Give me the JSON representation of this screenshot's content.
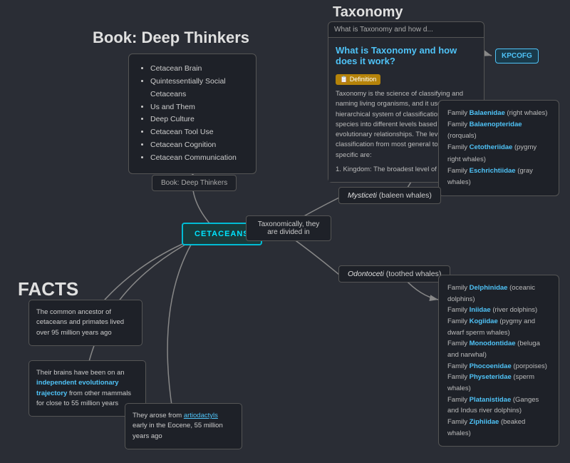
{
  "book": {
    "title": "Book: Deep Thinkers",
    "chapters": [
      "Cetacean Brain",
      "Quintessentially Social Cetaceans",
      "Us and Them",
      "Deep Culture",
      "Cetacean Tool Use",
      "Cetacean Cognition",
      "Cetacean Communication"
    ],
    "label": "Book: Deep Thinkers"
  },
  "taxonomy": {
    "title": "Taxonomy",
    "header": "What is Taxonomy and how d...",
    "card_title": "What is Taxonomy and how does it work?",
    "definition_badge": "📋 Definition",
    "body": "Taxonomy is the science of classifying and naming living organisms, and it uses a hierarchical system of classification to organize species into different levels based on their evolutionary relationships. The levels of classification from most general to most specific are:",
    "kingdom_line": "1. Kingdom: The broadest level of",
    "kpcofg": "KPCOFG"
  },
  "baleen_families": {
    "items": [
      {
        "name": "Balaenidae",
        "desc": " (right whales)"
      },
      {
        "name": "Balaenopteridae",
        "desc": " (rorquals)"
      },
      {
        "name": "Cetotheriidae",
        "desc": " (pygmy right whales)"
      },
      {
        "name": "Eschrichtiidae",
        "desc": " (gray whales)"
      }
    ]
  },
  "mysticeti": {
    "label": "Mysticeti (baleen whales)"
  },
  "cetaceans": {
    "label": "CETACEANS"
  },
  "taxonomically": {
    "label": "Taxonomically, they are divided in"
  },
  "odontoceti": {
    "label": "Odontoceti (toothed whales)"
  },
  "toothed_families": {
    "items": [
      {
        "name": "Delphinidae",
        "desc": " (oceanic dolphins)"
      },
      {
        "name": "Iniidae",
        "desc": " (river dolphins)"
      },
      {
        "name": "Kogiidae",
        "desc": " (pygmy and dwarf sperm whales)"
      },
      {
        "name": "Monodontidae",
        "desc": " (beluga and narwhal)"
      },
      {
        "name": "Phocoenidae",
        "desc": " (porpoises)"
      },
      {
        "name": "Physeteridae",
        "desc": " (sperm whales)"
      },
      {
        "name": "Platanistidae",
        "desc": " (Ganges and Indus river dolphins)"
      },
      {
        "name": "Ziphiidae",
        "desc": " (beaked whales)"
      }
    ]
  },
  "facts": {
    "title": "FACTS",
    "fact1": "The common ancestor of cetaceans and primates lived over 95 million years ago",
    "fact2_prefix": "Their brains have been on an ",
    "fact2_bold": "independent evolutionary trajectory",
    "fact2_suffix": " from other mammals for close to 55 million years",
    "fact3_prefix": "They arose from ",
    "fact3_link": "artiodactyls",
    "fact3_suffix": " early in the Eocene, 55 million years ago"
  }
}
